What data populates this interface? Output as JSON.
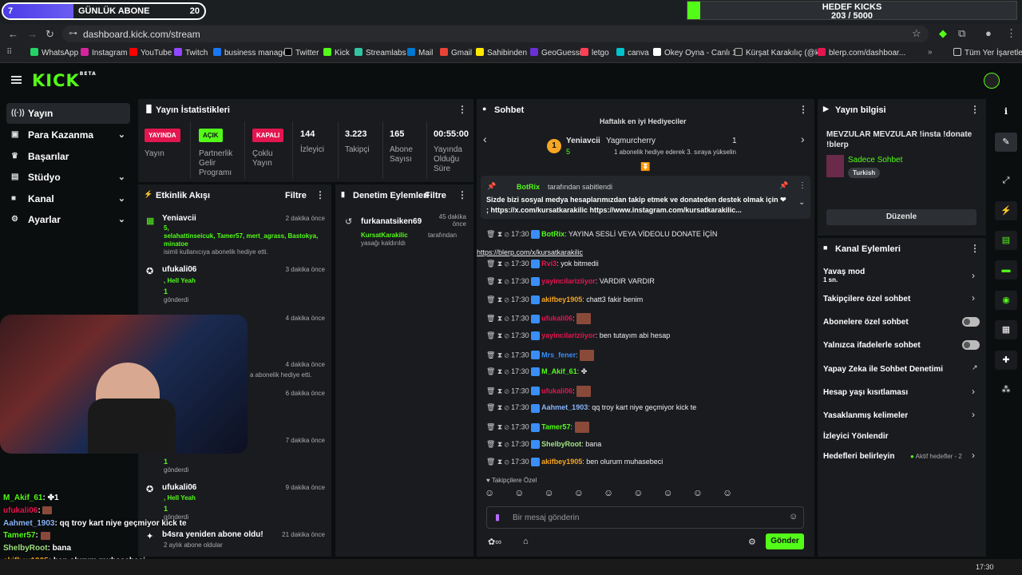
{
  "overlay": {
    "sub_goal": {
      "current": "7",
      "label": "GÜNLÜK ABONE",
      "target": "20",
      "progress": 0.35
    },
    "kicks_goal": {
      "title": "HEDEF KICKS",
      "value": "203 / 5000",
      "progress": 0.04
    }
  },
  "browser": {
    "url": "dashboard.kick.com/stream",
    "bookmarks": [
      "WhatsApp",
      "Instagram",
      "YouTube",
      "Twitch",
      "business manager",
      "Twitter",
      "Kick",
      "Streamlabs",
      "Mail",
      "Gmail",
      "Sahibinden",
      "GeoGuessr",
      "letgo",
      "canva",
      "Okey Oyna - Canlı 1...",
      "Kürşat Karakılıç (@k...",
      "blerp.com/dashboar..."
    ],
    "all_bookmarks": "Tüm Yer İşaretleri"
  },
  "nav": [
    {
      "label": "Yayın",
      "icon": "broadcast-icon",
      "chevron": false
    },
    {
      "label": "Para Kazanma",
      "icon": "money-icon",
      "chevron": true
    },
    {
      "label": "Başarılar",
      "icon": "trophy-icon",
      "chevron": false
    },
    {
      "label": "Stüdyo",
      "icon": "studio-icon",
      "chevron": true
    },
    {
      "label": "Kanal",
      "icon": "channel-icon",
      "chevron": true
    },
    {
      "label": "Ayarlar",
      "icon": "settings-icon",
      "chevron": true
    }
  ],
  "stats": {
    "title": "Yayın İstatistikleri",
    "badges": [
      {
        "badge": "YAYINDA",
        "label": "Yayın",
        "color": "#e3164f"
      },
      {
        "badge": "AÇIK",
        "label": "Partnerlik Gelir Programı",
        "color": "#53fc18"
      },
      {
        "badge": "KAPALI",
        "label": "Çoklu Yayın",
        "color": "#e3164f"
      }
    ],
    "numbers": [
      {
        "value": "144",
        "label": "İzleyici"
      },
      {
        "value": "3.223",
        "label": "Takipçi"
      },
      {
        "value": "165",
        "label": "Abone Sayısı"
      },
      {
        "value": "00:55:00",
        "label": "Yayında Olduğu Süre"
      }
    ]
  },
  "activity": {
    "title": "Etkinlik Akışı",
    "filter": "Filtre",
    "items": [
      {
        "who": "Yeniavcii",
        "time": "2 dakika önce",
        "l1": "5,",
        "l2": "selahattinseicuk, Tamer57, mert_agrass, Bastokya,",
        "l3": "minatoe",
        "l4": "isimli kullanıcıya abonelik hediye etti."
      },
      {
        "who": "ufukali06",
        "time": "3 dakika önce",
        "l1": ", Hell Yeah",
        "l2": "1",
        "l3": "gönderdi"
      },
      {
        "time": "4 dakika önce"
      },
      {
        "time": "4 dakika önce",
        "l1": "a abonelik hediye etti."
      },
      {
        "time": "6 dakika önce"
      },
      {
        "time": "7 dakika önce",
        "l2": "1",
        "l3": "gönderdi"
      },
      {
        "who": "ufukali06",
        "time": "9 dakika önce",
        "l1": ", Hell Yeah",
        "l2": "1",
        "l3": "gönderdi"
      },
      {
        "who": "b4sra yeniden abone oldu!",
        "time": "21 dakika önce",
        "l1": "2 aylık abone oldular"
      }
    ]
  },
  "moderation": {
    "title": "Denetim Eylemleri",
    "filter": "Filtre",
    "items": [
      {
        "who": "furkanatsiken69",
        "time": "45 dakika önce",
        "by": "KursatKarakilic",
        "action": "tarafından yasağı kaldırıldı"
      }
    ]
  },
  "chat": {
    "title": "Sohbet",
    "gifters_title": "Haftalık en iyi Hediyeciler",
    "gifter1": {
      "name": "Yeniavcii",
      "count": "5"
    },
    "gifter2": {
      "name": "Yagmurcherry",
      "count": "1"
    },
    "gifter_note": "1 abonelik hediye ederek 3. sıraya yükselin",
    "pinned_by": "BotRix",
    "pinned_by_suffix": "tarafından sabitlendi",
    "pinned_text": "Sizde bizi sosyal medya hesaplarımızdan takip etmek ve donateden destek olmak için ❤ ; https://x.com/kursatkarakilic https://www.instagram.com/kursatkarakilic...",
    "messages": [
      {
        "time": "17:30",
        "user": "BotRix",
        "color": "#53fc18",
        "text": ": YAYINA SESLİ VEYA VİDEOLU DONATE İÇİN"
      },
      {
        "time": "",
        "user": "",
        "color": "#fff",
        "text": "https://blerp.com/x/kursatkarakilic"
      },
      {
        "time": "17:30",
        "user": "Rvi3",
        "color": "#e3164f",
        "text": ": yok bitmedii"
      },
      {
        "time": "17:30",
        "user": "yayincilariziiyor",
        "color": "#e3164f",
        "text": ": VARDIR VARDIR"
      },
      {
        "time": "17:30",
        "user": "akifbey1905",
        "color": "#f5a623",
        "text": ": chatt3 fakir benim"
      },
      {
        "time": "17:30",
        "user": "ufukali06",
        "color": "#e3164f",
        "text": ":"
      },
      {
        "time": "17:30",
        "user": "yayincilariziiyor",
        "color": "#e3164f",
        "text": ": ben tutayım abi hesap"
      },
      {
        "time": "17:30",
        "user": "Mrs_fener",
        "color": "#3a8ef6",
        "text": ":"
      },
      {
        "time": "17:30",
        "user": "M_Akif_61",
        "color": "#53fc18",
        "text": ": ✤"
      },
      {
        "time": "17:30",
        "user": "ufukali06",
        "color": "#e3164f",
        "text": ":"
      },
      {
        "time": "17:30",
        "user": "Aahmet_1903",
        "color": "#8ab4f8",
        "text": ": qq troy kart niye geçmiyor kick te"
      },
      {
        "time": "17:30",
        "user": "Tamer57",
        "color": "#53fc18",
        "text": ":"
      },
      {
        "time": "17:30",
        "user": "ShelbyRoot",
        "color": "#a0e080",
        "text": ": bana"
      },
      {
        "time": "17:30",
        "user": "akifbey1905",
        "color": "#f5a623",
        "text": ": ben olurum muhasebeci"
      }
    ],
    "follower_only": "Takipçilere Özel",
    "input_placeholder": "Bir mesaj gönderin",
    "send": "Gönder"
  },
  "info": {
    "title": "Yayın bilgisi",
    "stream_title": "MEVZULAR MEVZULAR !insta !donate !blerp",
    "category": "Sadece Sohbet",
    "tag": "Turkish",
    "edit": "Düzenle"
  },
  "channel_actions": {
    "title": "Kanal Eylemleri",
    "slow_mode": "Yavaş mod",
    "slow_mode_value": "1 sn.",
    "followers_chat": "Takipçilere özel sohbet",
    "subs_chat": "Abonelere özel sohbet",
    "emote_chat": "Yalnızca ifadelerle sohbet",
    "ai_mod": "Yapay Zeka ile Sohbet Denetimi",
    "age": "Hesap yaşı kısıtlaması",
    "banned": "Yasaklanmış kelimeler",
    "host": "İzleyici Yönlendir",
    "goals": "Hedefleri belirleyin",
    "goals_status": "Aktif hedefler - 2"
  },
  "overlay_chat": [
    {
      "user": "M_Akif_61",
      "color": "#53fc18",
      "text": ": ✤1"
    },
    {
      "user": "ufukali06",
      "color": "#e3164f",
      "text": ":"
    },
    {
      "user": "Aahmet_1903",
      "color": "#8ab4f8",
      "text": ": qq troy kart niye geçmiyor kick te"
    },
    {
      "user": "Tamer57",
      "color": "#53fc18",
      "text": ":"
    },
    {
      "user": "ShelbyRoot",
      "color": "#a0e080",
      "text": ": bana"
    },
    {
      "user": "akifbey1905",
      "color": "#f5a623",
      "text": ": ben olurum muhasebeci"
    }
  ],
  "taskbar": {
    "time": "17:30"
  }
}
